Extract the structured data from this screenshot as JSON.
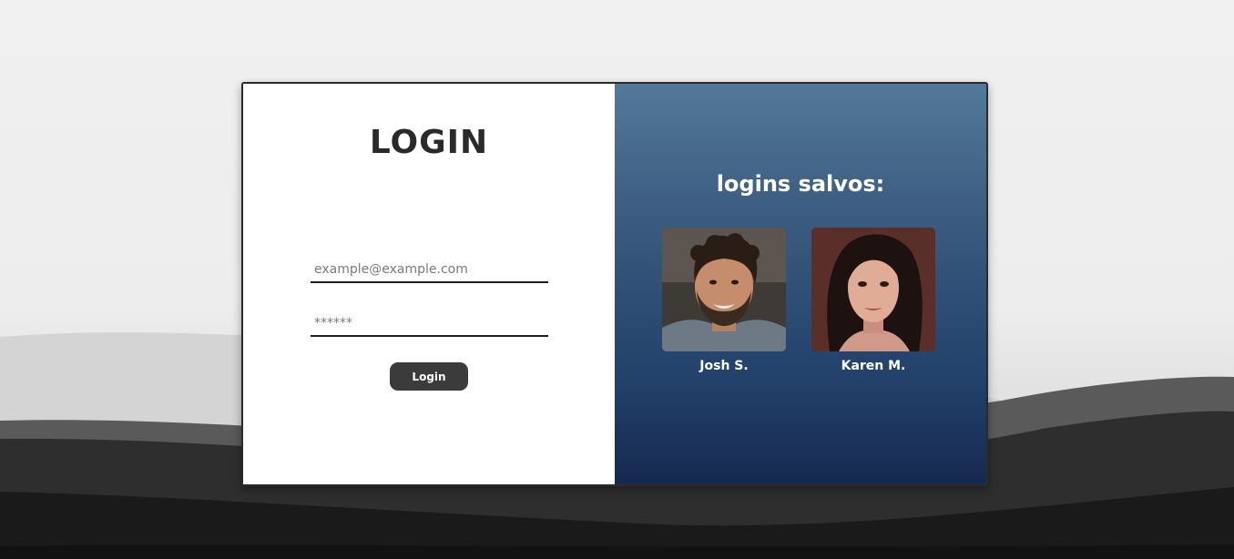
{
  "login_panel": {
    "title": "LOGIN",
    "email_placeholder": "example@example.com",
    "password_placeholder": "******",
    "login_button_label": "Login"
  },
  "saved_panel": {
    "title": "logins salvos:",
    "profiles": [
      {
        "name": "Josh S.",
        "avatar_icon": "man-avatar"
      },
      {
        "name": "Karen M.",
        "avatar_icon": "woman-avatar"
      }
    ]
  },
  "colors": {
    "button": "#3b3b3b",
    "panel_gradient_top": "#53799a",
    "panel_gradient_bottom": "#16294f"
  }
}
